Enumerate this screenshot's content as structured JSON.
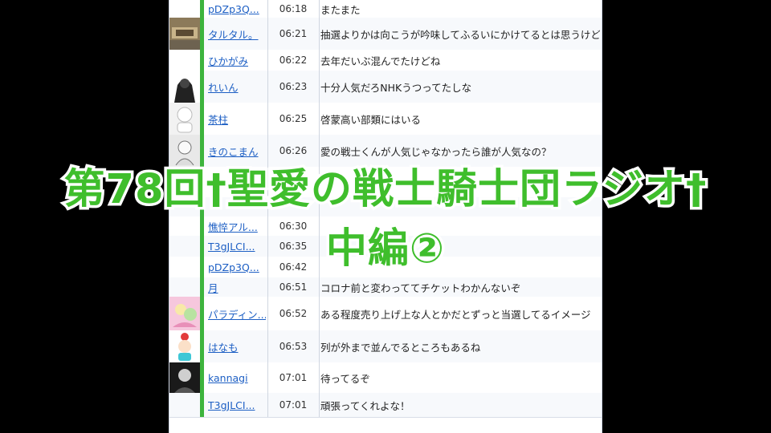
{
  "colors": {
    "overlay_text": "#3fbe2c",
    "overlay_outline": "#ffffff",
    "name_link": "#1d5fc4",
    "accent_bar": "#3db43d"
  },
  "comments": [
    {
      "name": "pDZp3Q...",
      "time": "06:18",
      "text": "またまた",
      "avatar": "none"
    },
    {
      "name": "タルタル。",
      "time": "06:21",
      "text": "抽選よりかは向こうが吟味してふるいにかけてるとは思うけど",
      "avatar": "photo"
    },
    {
      "name": "ひかがみ",
      "time": "06:22",
      "text": "去年だいぶ混んでたけどね",
      "avatar": "none"
    },
    {
      "name": "れいん",
      "time": "06:23",
      "text": "十分人気だろNHKうつってたしな",
      "avatar": "dark-figure"
    },
    {
      "name": "茶柱",
      "time": "06:25",
      "text": "啓蒙高い部類にはいる",
      "avatar": "white-face"
    },
    {
      "name": "きのこまん",
      "time": "06:26",
      "text": "愛の戦士くんが人気じゃなかったら誰が人気なの？",
      "avatar": "sketch"
    },
    {
      "name": "",
      "time": "",
      "text": "",
      "avatar": "none"
    },
    {
      "name": "",
      "time": "",
      "text": "",
      "avatar": "none"
    },
    {
      "name": "憔悴アル...",
      "time": "06:30",
      "text": "",
      "avatar": "none"
    },
    {
      "name": "T3gJLCI...",
      "time": "06:35",
      "text": "",
      "avatar": "none"
    },
    {
      "name": "pDZp3Q...",
      "time": "06:42",
      "text": "",
      "avatar": "none"
    },
    {
      "name": "月",
      "time": "06:51",
      "text": "コロナ前と変わっててチケットわかんないぞ",
      "avatar": "none"
    },
    {
      "name": "パラディン...",
      "time": "06:52",
      "text": "ある程度売り上げ上な人とかだとずっと当選してるイメージ",
      "avatar": "pink-art"
    },
    {
      "name": "はなも",
      "time": "06:53",
      "text": "列が外まで並んでるところもあるね",
      "avatar": "flower-face"
    },
    {
      "name": "kannagi",
      "time": "07:01",
      "text": "待ってるぞ",
      "avatar": "dark-portrait"
    },
    {
      "name": "T3gJLCI...",
      "time": "07:01",
      "text": "頑張ってくれよな！",
      "avatar": "none"
    }
  ],
  "overlay": {
    "line1": "第78回†聖愛の戦士騎士団ラジオ†",
    "line2": "中編②"
  }
}
